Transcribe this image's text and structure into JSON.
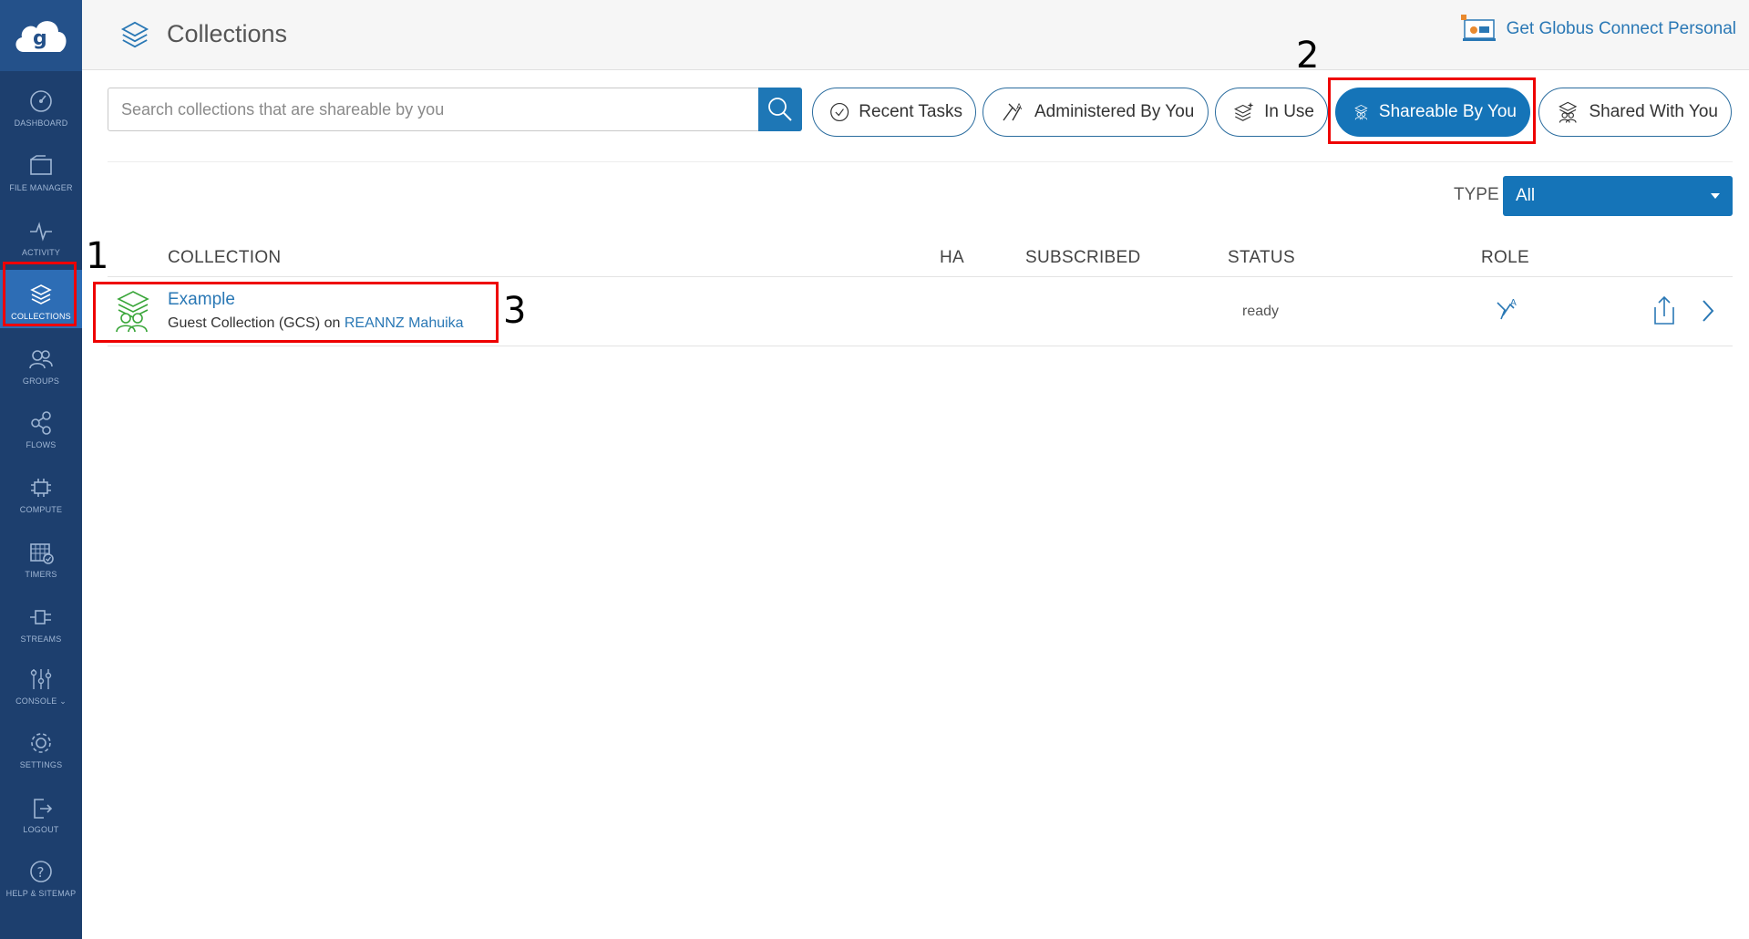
{
  "app": {
    "logo_icon": "globus-cloud-logo-icon"
  },
  "sidebar": {
    "items": [
      {
        "label": "DASHBOARD",
        "icon": "dashboard-gauge-icon"
      },
      {
        "label": "FILE MANAGER",
        "icon": "folder-icon"
      },
      {
        "label": "ACTIVITY",
        "icon": "activity-pulse-icon"
      },
      {
        "label": "COLLECTIONS",
        "icon": "layers-icon",
        "active": true
      },
      {
        "label": "GROUPS",
        "icon": "groups-icon"
      },
      {
        "label": "FLOWS",
        "icon": "flows-icon"
      },
      {
        "label": "COMPUTE",
        "icon": "compute-chip-icon"
      },
      {
        "label": "TIMERS",
        "icon": "calendar-check-icon"
      },
      {
        "label": "STREAMS",
        "icon": "streams-plug-icon"
      },
      {
        "label": "CONSOLE",
        "icon": "sliders-icon"
      },
      {
        "label": "SETTINGS",
        "icon": "gear-icon"
      },
      {
        "label": "LOGOUT",
        "icon": "logout-icon"
      },
      {
        "label": "HELP & SITEMAP",
        "icon": "help-icon"
      }
    ]
  },
  "header": {
    "title": "Collections",
    "get_gcp_label": "Get Globus Connect Personal"
  },
  "search": {
    "placeholder": "Search collections that are shareable by you"
  },
  "filters": [
    {
      "label": "Recent Tasks",
      "icon": "clock-icon"
    },
    {
      "label": "Administered By You",
      "icon": "admin-tools-icon"
    },
    {
      "label": "In Use",
      "icon": "layers-sparkle-icon"
    },
    {
      "label": "Shareable By You",
      "icon": "shareable-people-icon",
      "active": true
    },
    {
      "label": "Shared With You",
      "icon": "shared-people-icon"
    }
  ],
  "type_filter": {
    "label": "TYPE",
    "value": "All"
  },
  "table": {
    "headers": [
      "COLLECTION",
      "HA",
      "SUBSCRIBED",
      "STATUS",
      "ROLE"
    ],
    "rows": [
      {
        "name": "Example",
        "subtitle_prefix": "Guest Collection (GCS) on ",
        "endpoint": "REANNZ Mahuika",
        "status": "ready",
        "role_icon": "administrator-role-icon"
      }
    ]
  },
  "annotations": {
    "marker1": "1",
    "marker2": "2",
    "marker3": "3"
  },
  "colors": {
    "sidebar": "#1d3f6e",
    "accent": "#1574b8",
    "highlight": "#ee0000",
    "link": "#2a78b5"
  }
}
